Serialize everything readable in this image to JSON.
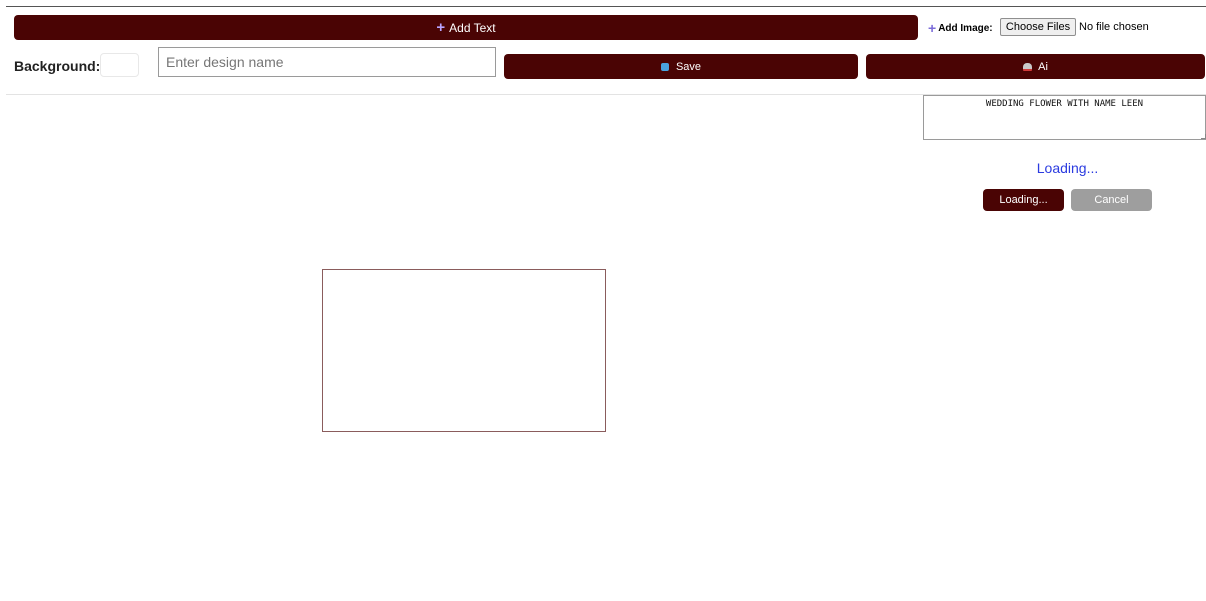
{
  "toolbar": {
    "add_text_label": "Add Text",
    "add_image_label": "Add Image:",
    "choose_files_label": "Choose Files",
    "file_status": "No file chosen",
    "background_label": "Background:",
    "background_color": "#ffffff",
    "design_name_placeholder": "Enter design name",
    "design_name_value": "",
    "save_label": "Save",
    "ai_label": "Ai"
  },
  "ai_panel": {
    "prompt_value": "WEDDING FLOWER WITH NAME LEEN",
    "status_text": "Loading...",
    "loading_button_label": "Loading...",
    "cancel_button_label": "Cancel"
  },
  "colors": {
    "accent": "#4a0404",
    "status": "#2b3be0",
    "cancel": "#9e9e9e"
  },
  "icons": {
    "add_text": "plus-icon",
    "add_image": "plus-icon",
    "save": "floppy-icon",
    "ai": "robot-icon"
  }
}
